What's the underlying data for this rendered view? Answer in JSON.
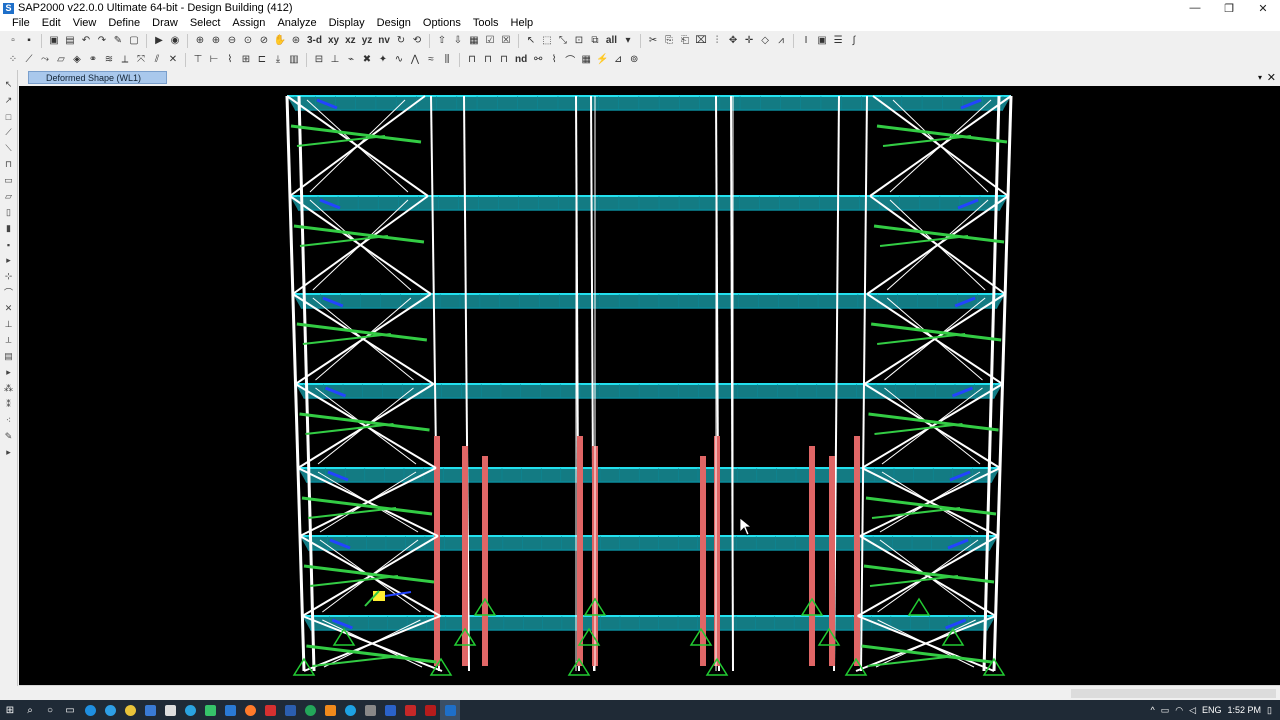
{
  "window": {
    "title": "SAP2000 v22.0.0 Ultimate 64-bit - Design Building (412)",
    "app_icon_letter": "S",
    "minimize": "—",
    "restore": "❐",
    "close": "✕"
  },
  "menu": [
    "File",
    "Edit",
    "View",
    "Define",
    "Draw",
    "Select",
    "Assign",
    "Analyze",
    "Display",
    "Design",
    "Options",
    "Tools",
    "Help"
  ],
  "toolbar": {
    "view_3d": "3-d",
    "view_xy": "xy",
    "view_xz": "xz",
    "view_yz": "yz",
    "view_nv": "nv",
    "select_all": "all",
    "nd": "nd"
  },
  "tab": {
    "label": "Deformed Shape (WL1)",
    "menu_glyph": "▾",
    "close_glyph": "✕"
  },
  "viewport": {
    "background": "#000000",
    "colors": {
      "frame": "#ffffff",
      "slab": "#22e0ee",
      "slab_dark": "#0a8a9a",
      "column_stressed": "#e06666",
      "brace_green": "#33cc44",
      "support": "#22cc33",
      "accent_blue": "#2244ff",
      "axis_yellow": "#ffee33"
    }
  },
  "taskbar": {
    "language": "ENG",
    "time": "1:52 PM",
    "tray_up": "^"
  }
}
